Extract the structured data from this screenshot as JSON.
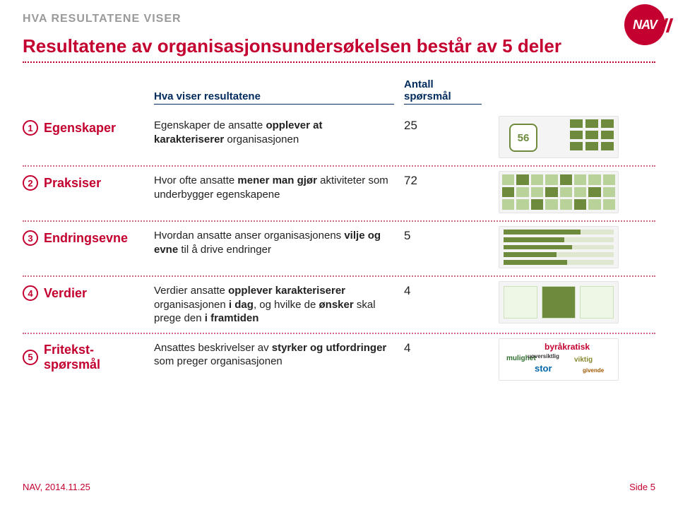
{
  "header": {
    "kicker": "HVA RESULTATENE VISER",
    "logo_text": "NAV",
    "headline": "Resultatene av organisasjonsundersøkelsen består av 5 deler"
  },
  "columns": {
    "desc_header": "Hva viser resultatene",
    "count_header": "Antall spørsmål"
  },
  "sections": [
    {
      "num": "1",
      "label": "Egenskaper",
      "desc_html": "Egenskaper de ansatte <b>opplever at karakteriserer</b> organisasjonen",
      "count": "25",
      "thumb_value": "56"
    },
    {
      "num": "2",
      "label": "Praksiser",
      "desc_html": "Hvor ofte ansatte <b>mener man gjør</b> aktiviteter som underbygger egenskapene",
      "count": "72"
    },
    {
      "num": "3",
      "label": "Endringsevne",
      "desc_html": "Hvordan ansatte anser organisasjonens <b>vilje og evne</b> til å drive endringer",
      "count": "5"
    },
    {
      "num": "4",
      "label": "Verdier",
      "desc_html": "Verdier ansatte <b>opplever karakteriserer</b> organisasjonen <b>i dag</b>, og hvilke de <b>ønsker</b> skal prege den <b>i framtiden</b>",
      "count": "4"
    },
    {
      "num": "5",
      "label": "Fritekst-spørsmål",
      "desc_html": "Ansattes beskrivelser av <b>styrker og utfordringer</b> som preger organisasjonen",
      "count": "4",
      "cloud": {
        "w1": "byråkratisk",
        "w2": "mulighet",
        "w3": "viktig",
        "w4": "stor",
        "w5": "uoversiktlig",
        "w6": "givende"
      }
    }
  ],
  "footer": {
    "left": "NAV, 2014.11.25",
    "right": "Side 5"
  }
}
